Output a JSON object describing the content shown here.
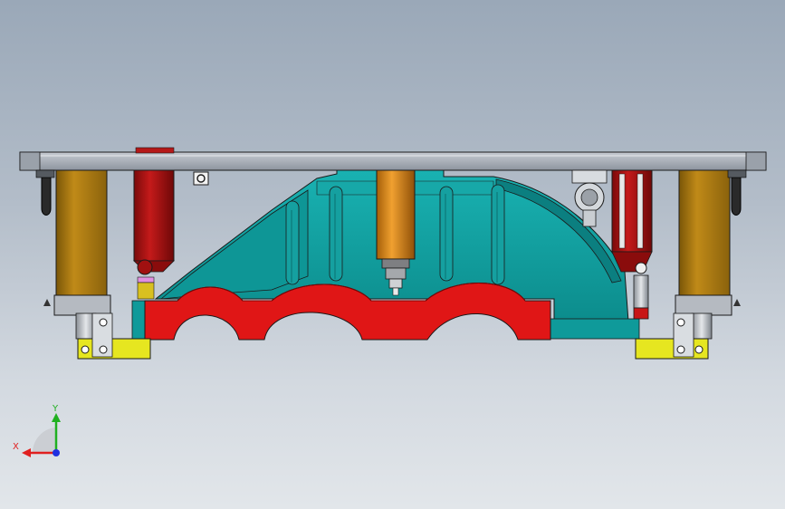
{
  "view": {
    "triad": {
      "x_label": "X",
      "y_label": "Y",
      "x_color": "#e02020",
      "y_color": "#20b020",
      "z_color": "#2030e0"
    }
  },
  "colors": {
    "base_plate": "#a7adb6",
    "casting_body": "#14a3a3",
    "casting_shadow": "#0a7f80",
    "cradle_block": "#e31919",
    "side_column": "#b07d10",
    "left_cylinder": "#b21414",
    "center_cylinder": "#d98a1a",
    "foot_bracket": "#e6e61a",
    "outline": "#1a1a1a"
  }
}
